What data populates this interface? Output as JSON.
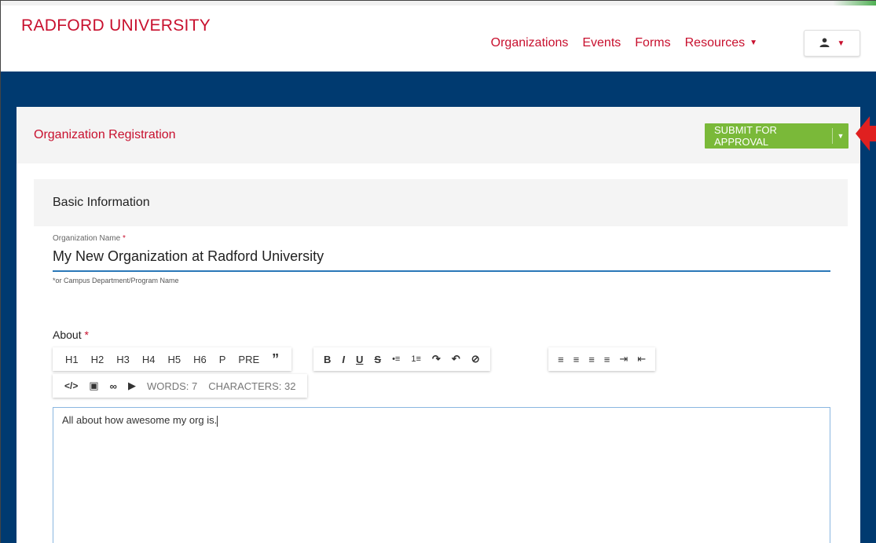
{
  "header": {
    "brand": "RADFORD UNIVERSITY",
    "nav": [
      "Organizations",
      "Events",
      "Forms",
      "Resources"
    ]
  },
  "panel": {
    "title": "Organization Registration",
    "submit_label": "SUBMIT FOR APPROVAL"
  },
  "section": {
    "title": "Basic Information"
  },
  "org_name": {
    "label": "Organization Name",
    "required_mark": "*",
    "value": "My New Organization at Radford University",
    "hint": "*or Campus Department/Program Name"
  },
  "about": {
    "label": "About",
    "required_mark": "*",
    "text": "All about how awesome my org is."
  },
  "toolbar": {
    "headings": [
      "H1",
      "H2",
      "H3",
      "H4",
      "H5",
      "H6",
      "P",
      "PRE",
      "”"
    ],
    "format": [
      "B",
      "I",
      "U",
      "S",
      "•≡",
      "1≡",
      "↷",
      "↶",
      "⊘"
    ],
    "align": [
      "≡",
      "≡",
      "≡",
      "≡",
      "⇥",
      "⇤"
    ],
    "insert": [
      "</>",
      "▣",
      "∞",
      "▶"
    ],
    "words": "WORDS: 7",
    "characters": "CHARACTERS: 32"
  },
  "colors": {
    "brand_red": "#c8102e",
    "navy": "#003a70",
    "submit_green": "#7ab939",
    "focus_blue": "#2a77b8",
    "arrow_red": "#e02020"
  },
  "icons": {
    "user": "user-icon",
    "dropdown": "chevron-down-icon",
    "annotation": "red-arrow-icon"
  }
}
